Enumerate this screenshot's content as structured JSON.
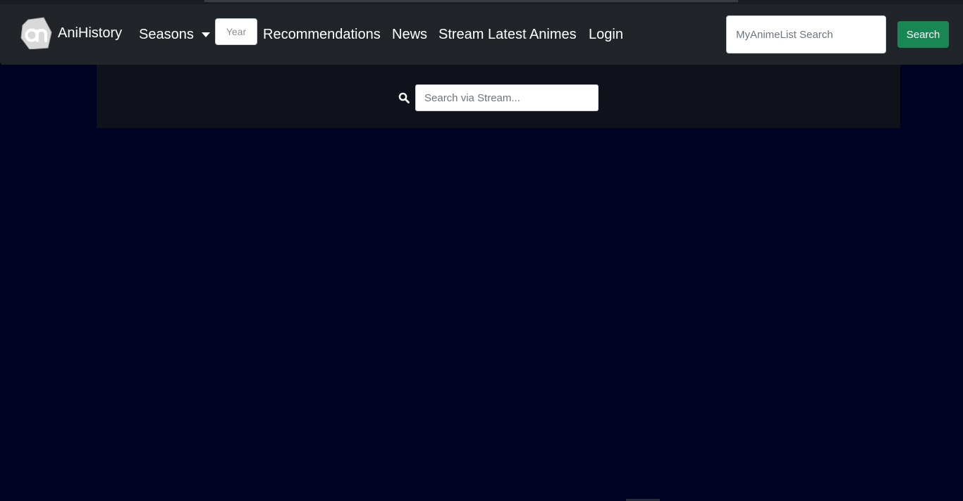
{
  "navbar": {
    "brand": {
      "name": "AniHistory",
      "logo_icon": "anihistory-logo-icon"
    },
    "seasons_label": "Seasons",
    "year_placeholder": "Year",
    "links": {
      "recommendations": "Recommendations",
      "news": "News",
      "stream": "Stream Latest Animes",
      "login": "Login"
    },
    "mal_search_placeholder": "MyAnimeList Search",
    "search_button": "Search"
  },
  "stream_search": {
    "icon": "search-icon",
    "placeholder": "Search via Stream..."
  },
  "colors": {
    "page_background": "#000222",
    "navbar_background": "#212529",
    "panel_background": "#0f111b",
    "search_button": "#198754"
  }
}
